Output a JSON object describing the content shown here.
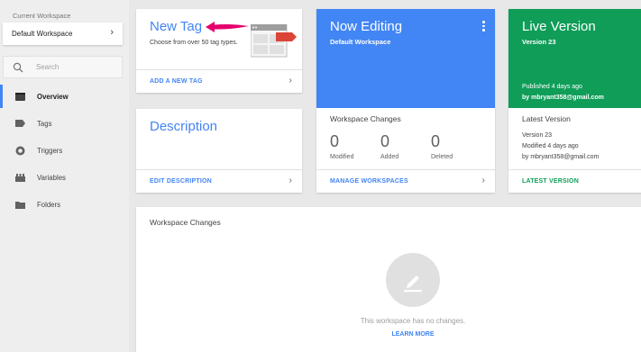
{
  "sidebar": {
    "workspace_label": "Current Workspace",
    "workspace_name": "Default Workspace",
    "search_placeholder": "Search",
    "items": [
      {
        "label": "Overview",
        "icon": "overview-icon",
        "active": true
      },
      {
        "label": "Tags",
        "icon": "tag-icon"
      },
      {
        "label": "Triggers",
        "icon": "trigger-icon"
      },
      {
        "label": "Variables",
        "icon": "variables-icon"
      },
      {
        "label": "Folders",
        "icon": "folder-icon"
      }
    ]
  },
  "new_tag": {
    "title": "New Tag",
    "description": "Choose from over 50 tag types.",
    "action": "ADD A NEW TAG"
  },
  "description_card": {
    "title": "Description",
    "action": "EDIT DESCRIPTION"
  },
  "now_editing": {
    "title": "Now Editing",
    "workspace": "Default Workspace",
    "changes_title": "Workspace Changes",
    "stats": [
      {
        "value": "0",
        "label": "Modified"
      },
      {
        "value": "0",
        "label": "Added"
      },
      {
        "value": "0",
        "label": "Deleted"
      }
    ],
    "action": "MANAGE WORKSPACES"
  },
  "live_version": {
    "title": "Live Version",
    "version": "Version 23",
    "published": "Published 4 days ago",
    "published_by": "by mbryant358@gmail.com",
    "latest_title": "Latest Version",
    "latest_version": "Version 23",
    "latest_modified": "Modified 4 days ago",
    "latest_by": "by mbryant358@gmail.com",
    "action": "LATEST VERSION"
  },
  "workspace_changes": {
    "title": "Workspace Changes",
    "empty_text": "This workspace has no changes.",
    "action": "LEARN MORE"
  },
  "colors": {
    "accent": "#4285f4",
    "live": "#0f9d58",
    "annotation_arrow": "#e5006d"
  }
}
